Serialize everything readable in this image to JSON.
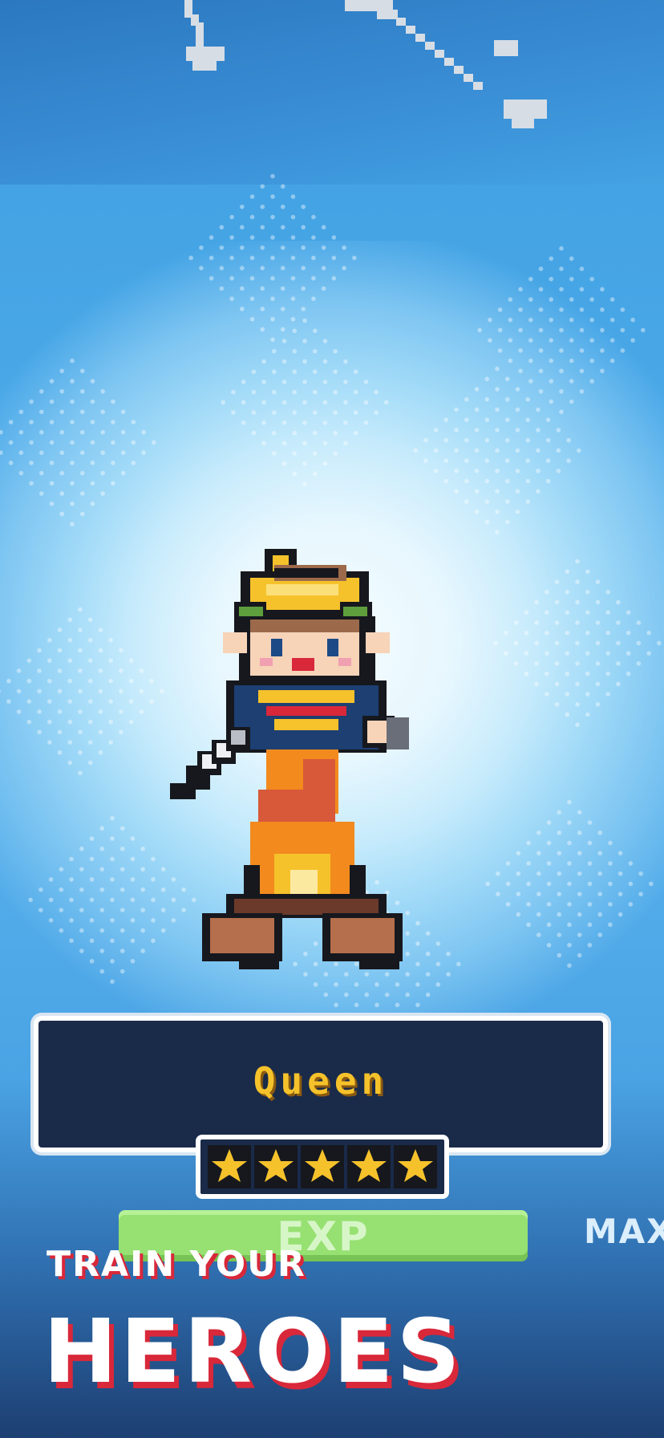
{
  "hero": {
    "name": "Queen",
    "star_count": 5,
    "exp_label": "EXP",
    "exp_fill": 1.0,
    "level_status": "MAX"
  },
  "promo": {
    "line1": "TRAIN YOUR",
    "line2": "HEROES"
  },
  "colors": {
    "name_text": "#f6c22b",
    "plate_bg": "#1a2a49",
    "exp_bar": "#97e072",
    "promo_shadow": "#d8283a",
    "star_fill": "#f6c22b"
  },
  "icons": [
    "chain-icon",
    "star-icon",
    "hero-sprite"
  ]
}
